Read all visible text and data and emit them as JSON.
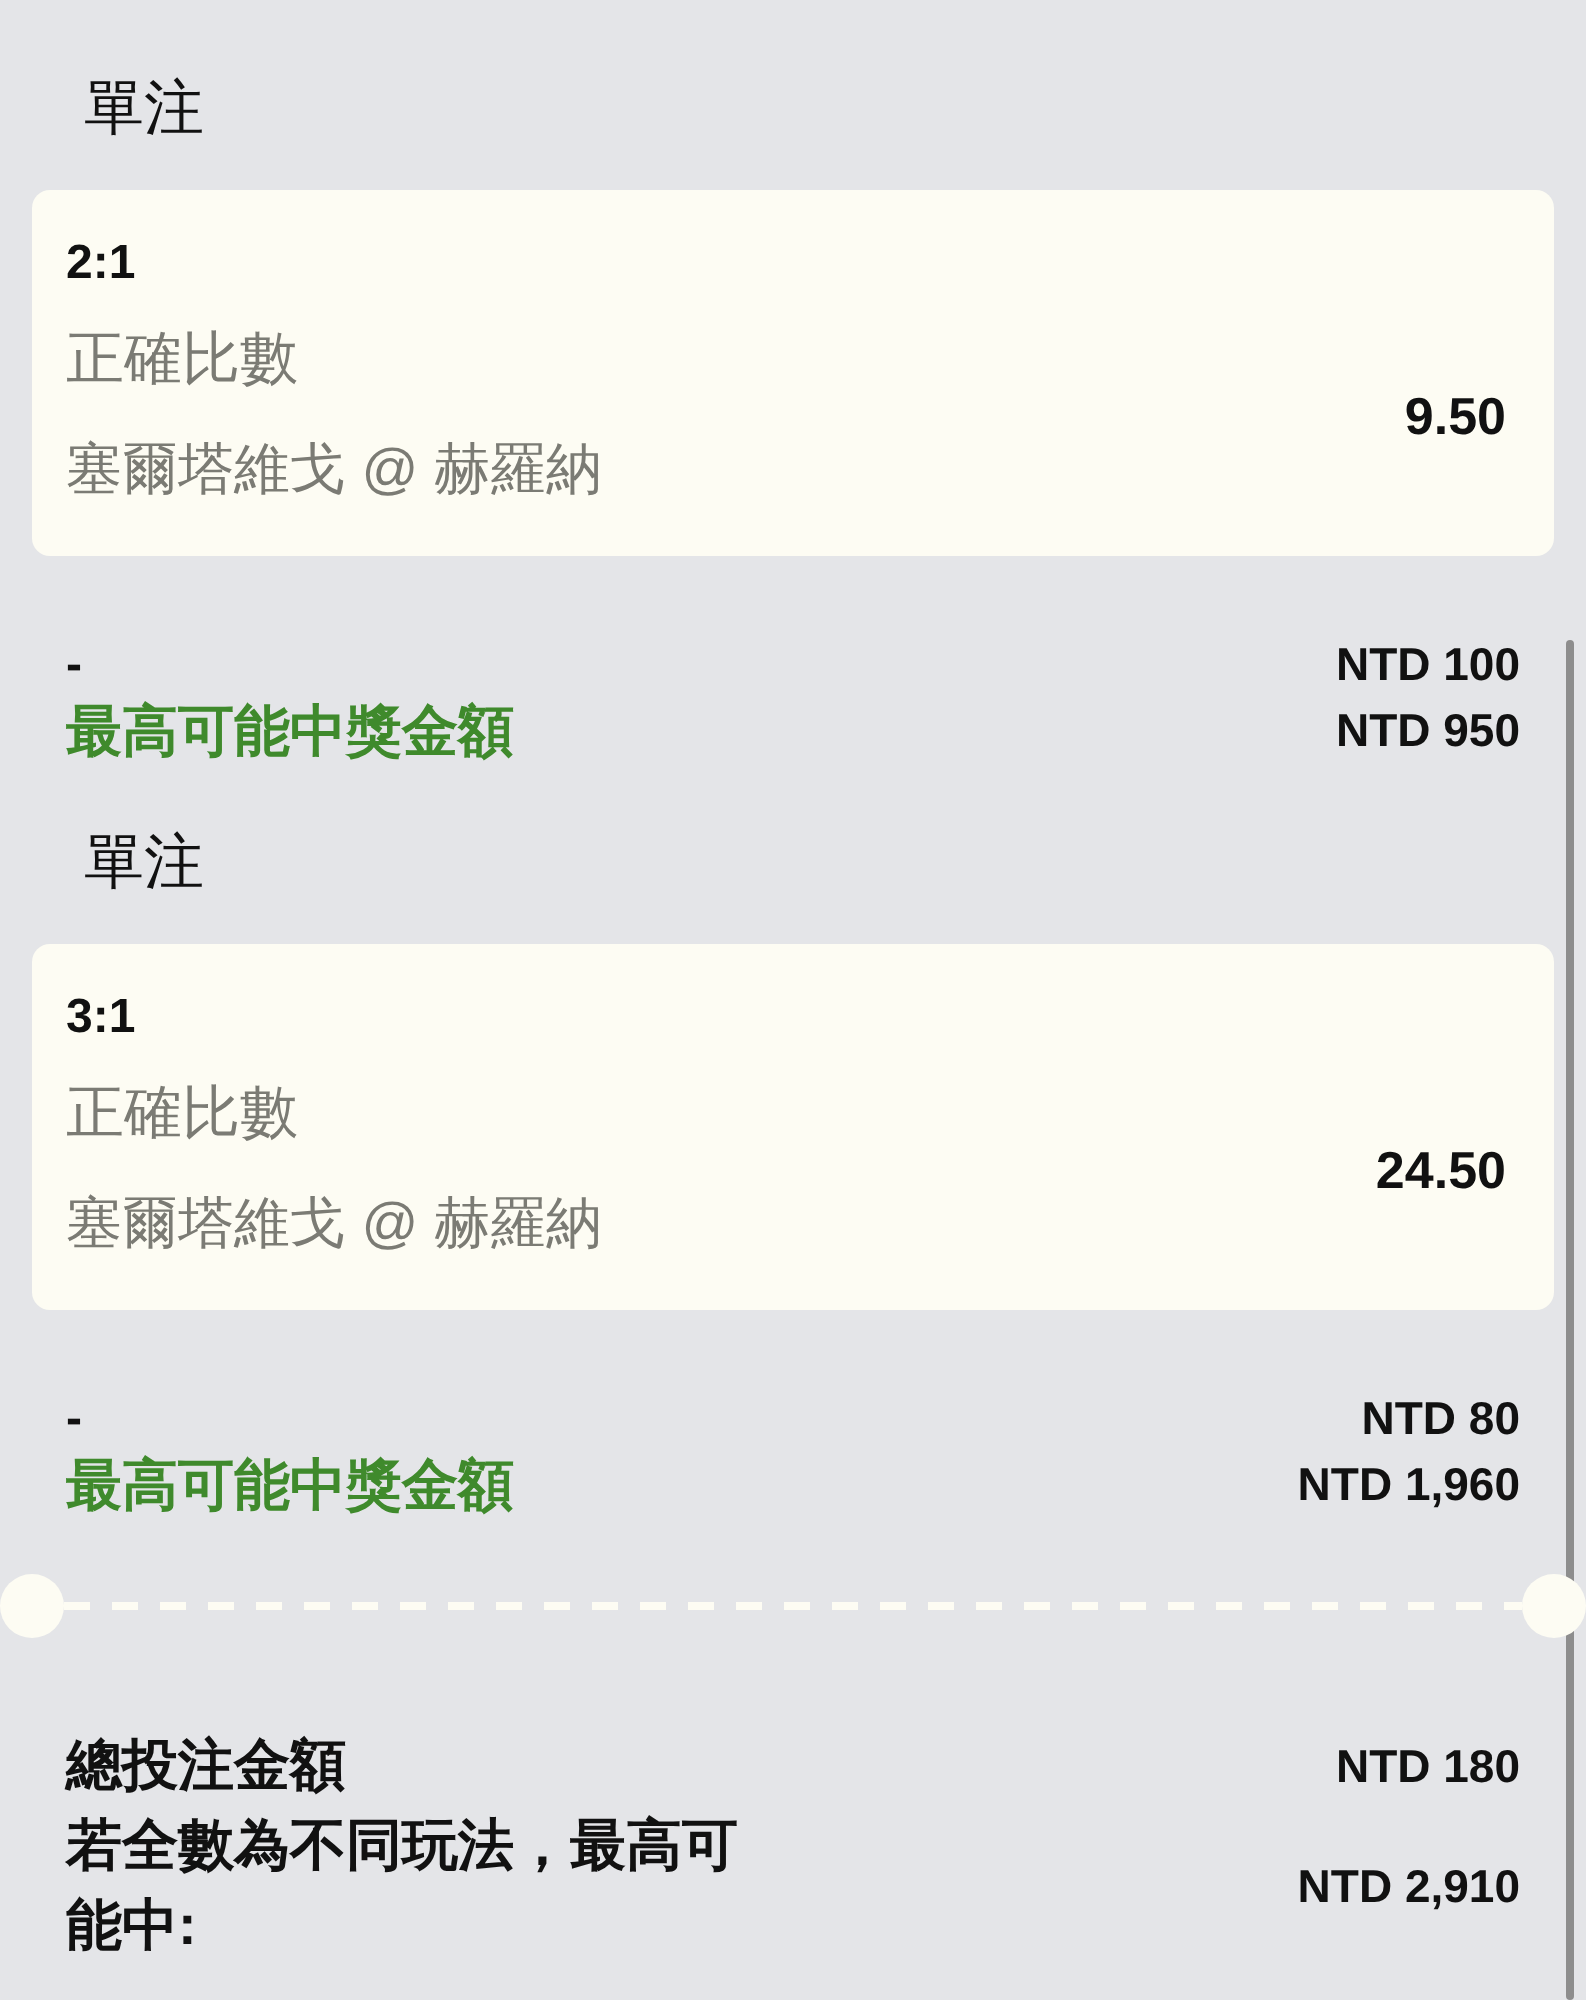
{
  "bets": [
    {
      "bet_type": "單注",
      "selection": "2:1",
      "market": "正確比數",
      "event": "塞爾塔維戈 @ 赫羅納",
      "odds": "9.50",
      "stake_label": "-",
      "stake": "NTD 100",
      "payout_label": "最高可能中獎金額",
      "payout": "NTD 950"
    },
    {
      "bet_type": "單注",
      "selection": "3:1",
      "market": "正確比數",
      "event": "塞爾塔維戈 @ 赫羅納",
      "odds": "24.50",
      "stake_label": "-",
      "stake": "NTD 80",
      "payout_label": "最高可能中獎金額",
      "payout": "NTD 1,960"
    }
  ],
  "totals": {
    "stake_label": "總投注金額",
    "stake": "NTD 180",
    "win_label": "若全數為不同玩法，最高可能中:",
    "win": "NTD 2,910"
  }
}
